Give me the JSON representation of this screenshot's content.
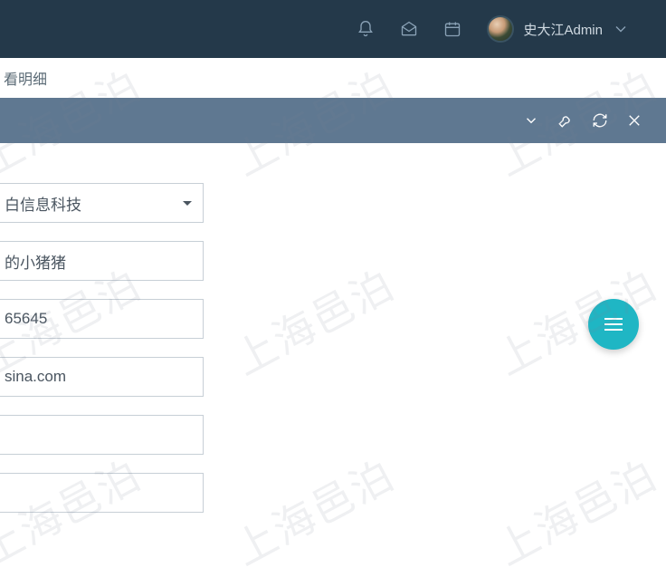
{
  "header": {
    "user_name": "史大江Admin"
  },
  "breadcrumb": {
    "tail": "看明细"
  },
  "form": {
    "company_fragment": "白信息科技",
    "name_fragment": "的小猪猪",
    "phone_fragment": "65645",
    "email_fragment": "sina.com",
    "field5": "",
    "field6": ""
  },
  "watermark": {
    "text": "上海邑泊"
  }
}
